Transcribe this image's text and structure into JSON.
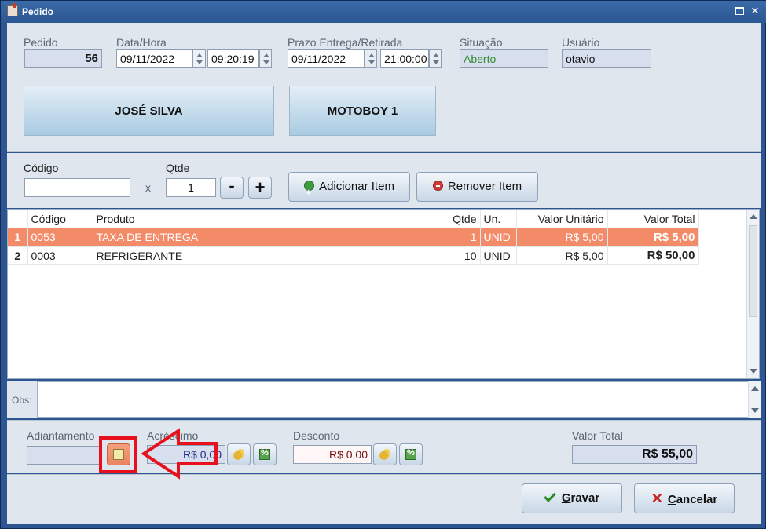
{
  "window": {
    "title": "Pedido"
  },
  "header": {
    "pedido_label": "Pedido",
    "pedido_value": "56",
    "datahora_label": "Data/Hora",
    "data_value": "09/11/2022",
    "hora_value": "09:20:19",
    "prazo_label": "Prazo Entrega/Retirada",
    "prazo_data": "09/11/2022",
    "prazo_hora": "21:00:00",
    "situacao_label": "Situação",
    "situacao_value": "Aberto",
    "usuario_label": "Usuário",
    "usuario_value": "otavio",
    "client_button": "JOSÉ SILVA",
    "motoboy_button": "MOTOBOY 1"
  },
  "item_entry": {
    "codigo_label": "Código",
    "codigo_value": "",
    "qtde_label": "Qtde",
    "x_label": "x",
    "qtde_value": "1",
    "minus": "-",
    "plus": "+",
    "add_button": "Adicionar Item",
    "remove_button": "Remover Item"
  },
  "grid": {
    "columns": [
      "Código",
      "Produto",
      "Qtde",
      "Un.",
      "Valor Unitário",
      "Valor Total"
    ],
    "rows": [
      {
        "idx": "1",
        "codigo": "0053",
        "produto": "TAXA DE ENTREGA",
        "qtde": "1",
        "un": "UNID",
        "unit": "R$ 5,00",
        "total": "R$ 5,00"
      },
      {
        "idx": "2",
        "codigo": "0003",
        "produto": "REFRIGERANTE",
        "qtde": "10",
        "un": "UNID",
        "unit": "R$ 5,00",
        "total": "R$ 50,00"
      }
    ]
  },
  "obs": {
    "label": "Obs:",
    "value": ""
  },
  "totals": {
    "adiantamento_label": "Adiantamento",
    "adiantamento_value": "",
    "acrescimo_label": "Acréscimo",
    "acrescimo_value": "R$ 0,00",
    "desconto_label": "Desconto",
    "desconto_value": "R$ 0,00",
    "total_label": "Valor Total",
    "total_value": "R$ 55,00"
  },
  "footer": {
    "save_key": "G",
    "save_rest": "ravar",
    "cancel_key": "C",
    "cancel_rest": "ancelar"
  },
  "colors": {
    "selected_row": "#f48b68",
    "highlight": "#e8101c",
    "situacao_text": "#2e8b2e"
  }
}
